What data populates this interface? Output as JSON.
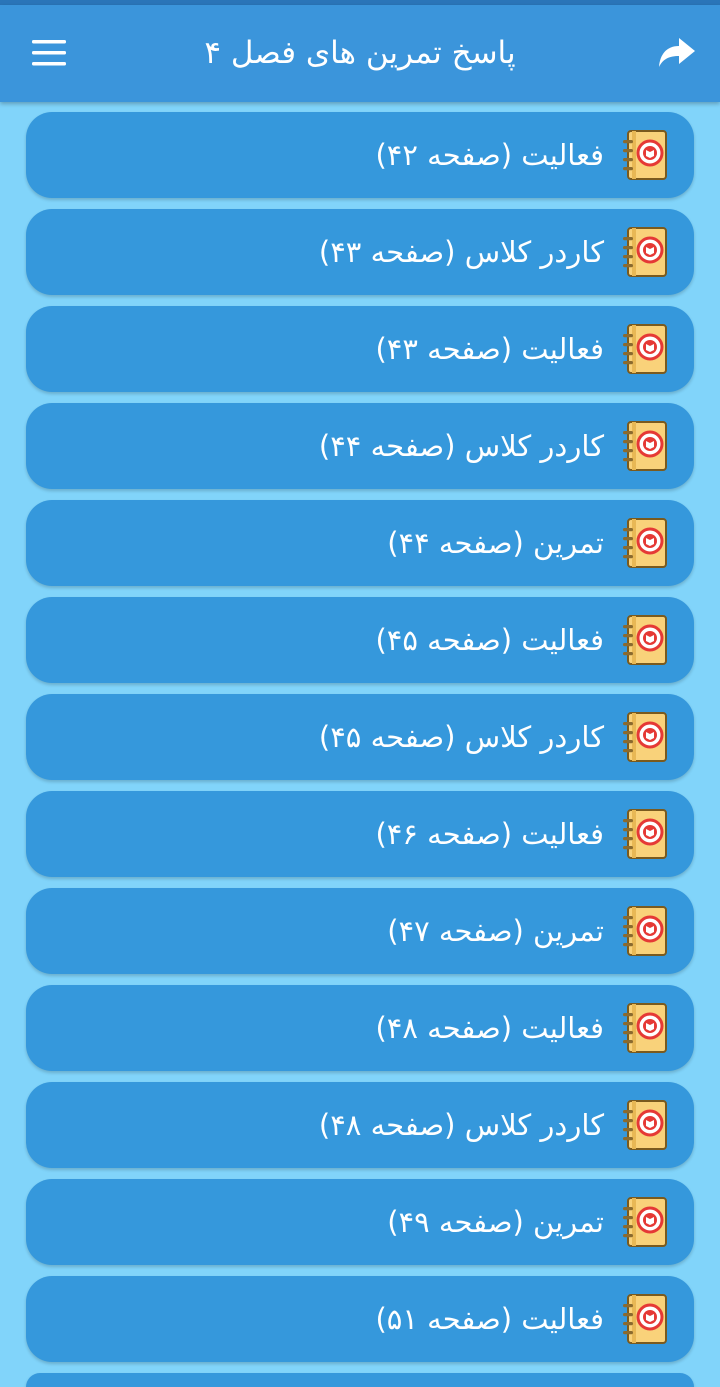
{
  "header": {
    "title": "پاسخ تمرین های فصل ۴"
  },
  "items": [
    {
      "label": "فعالیت (صفحه ۴۲)",
      "icon": "notebook-icon"
    },
    {
      "label": "کاردر کلاس (صفحه ۴۳)",
      "icon": "notebook-icon"
    },
    {
      "label": "فعالیت (صفحه ۴۳)",
      "icon": "notebook-icon"
    },
    {
      "label": "کاردر کلاس (صفحه ۴۴)",
      "icon": "notebook-icon"
    },
    {
      "label": "تمرین (صفحه ۴۴)",
      "icon": "notebook-icon"
    },
    {
      "label": "فعالیت (صفحه ۴۵)",
      "icon": "notebook-icon"
    },
    {
      "label": "کاردر کلاس (صفحه ۴۵)",
      "icon": "notebook-icon"
    },
    {
      "label": "فعالیت (صفحه ۴۶)",
      "icon": "notebook-icon"
    },
    {
      "label": "تمرین (صفحه ۴۷)",
      "icon": "notebook-icon"
    },
    {
      "label": "فعالیت (صفحه ۴۸)",
      "icon": "notebook-icon"
    },
    {
      "label": "کاردر کلاس (صفحه ۴۸)",
      "icon": "notebook-icon"
    },
    {
      "label": "تمرین (صفحه ۴۹)",
      "icon": "notebook-icon"
    },
    {
      "label": "فعالیت (صفحه ۵۱)",
      "icon": "notebook-icon"
    }
  ],
  "colors": {
    "background": "#81d4fa",
    "app_bar": "#3b95db",
    "item": "#3598dc",
    "text": "#ffffff",
    "icon_paper": "#f9d27a",
    "icon_badge": "#e53935"
  }
}
